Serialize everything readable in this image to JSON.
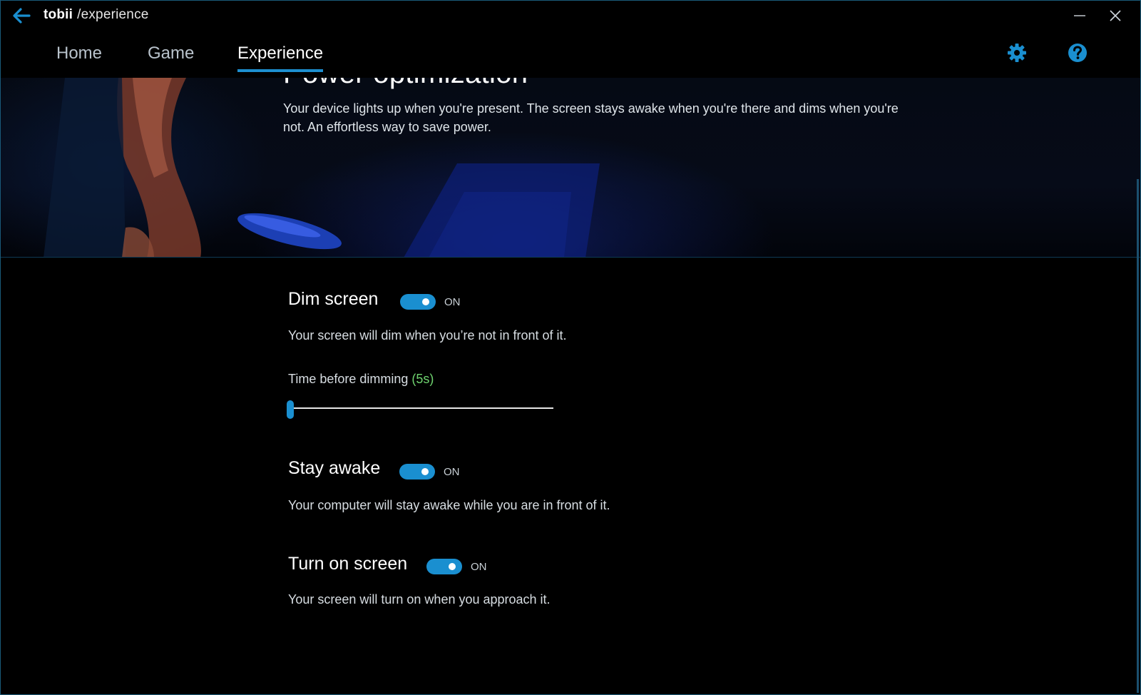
{
  "titlebar": {
    "brand": "tobii",
    "path": "/experience"
  },
  "nav": {
    "tabs": [
      {
        "label": "Home"
      },
      {
        "label": "Game"
      },
      {
        "label": "Experience"
      }
    ],
    "active_tab": "Experience"
  },
  "hero": {
    "title": "Power optimization",
    "description": "Your device lights up when you're present. The screen stays awake when you're there and dims when you're not. An effortless way to save power."
  },
  "settings": {
    "dim_screen": {
      "title": "Dim screen",
      "state": "ON",
      "description": "Your screen will dim when you’re not in front of it."
    },
    "dimming_time": {
      "label": "Time before dimming",
      "value": "(5s)",
      "slider_level": 0
    },
    "stay_awake": {
      "title": "Stay awake",
      "state": "ON",
      "description": "Your computer will stay awake while you are in front of it."
    },
    "turn_on_screen": {
      "title": "Turn on screen",
      "state": "ON",
      "description": "Your screen will turn on when you approach it."
    }
  },
  "colors": {
    "accent": "#1a8fd0",
    "value_green": "#6fd36f",
    "background": "#000000"
  },
  "icons": {
    "back": "back-arrow-icon",
    "minimize": "minimize-icon",
    "close": "close-icon",
    "settings": "gear-icon",
    "help": "help-icon"
  }
}
